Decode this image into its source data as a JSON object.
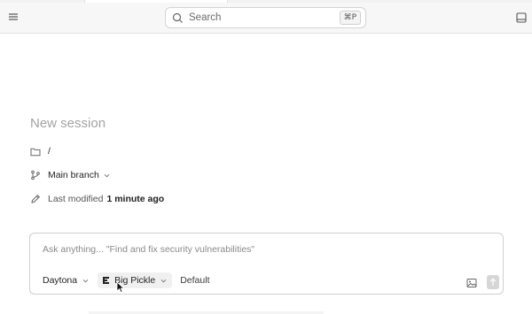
{
  "header": {
    "menu_icon": "hamburger-menu-icon",
    "search": {
      "placeholder": "Search",
      "shortcut": "⌘P",
      "icon": "search-icon"
    },
    "panel_icon": "panel-toggle-icon"
  },
  "session": {
    "title": "New session",
    "path": "/",
    "branch": "Main branch",
    "last_modified_label": "Last modified",
    "last_modified_value": "1 minute ago"
  },
  "composer": {
    "placeholder": "Ask anything... \"Find and fix security vulnerabilities\"",
    "sandbox": "Daytona",
    "model": "Big Pickle",
    "mode": "Default",
    "image_icon": "image-attach-icon",
    "send_icon": "arrow-up-icon"
  },
  "colors": {
    "topbar_bg": "#f7f7f7",
    "title_color": "#a4a4a4",
    "send_disabled": "#d6d6d6"
  }
}
